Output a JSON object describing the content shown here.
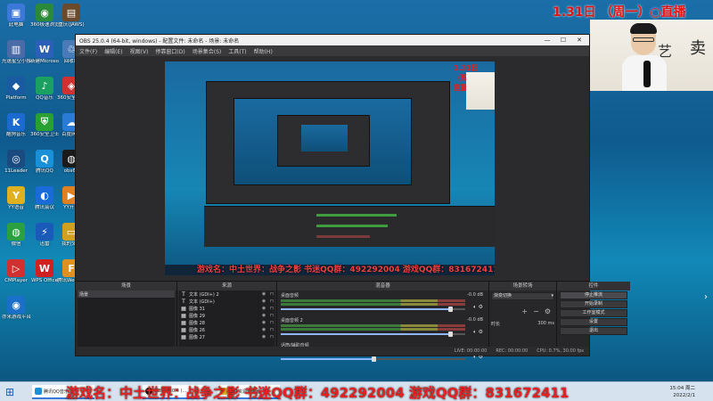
{
  "desktop_icons": [
    {
      "label": "此电脑",
      "color": "#3b78d8",
      "glyph": "▣"
    },
    {
      "label": "360极速浏览器",
      "color": "#2a8a3a",
      "glyph": "◉"
    },
    {
      "label": "重庆(JAWS)",
      "color": "#6a4a2a",
      "glyph": "▤"
    },
    {
      "label": "光速星空小报",
      "color": "#4a6aa8",
      "glyph": "▥"
    },
    {
      "label": "新建Microsoft...",
      "color": "#2b5fb8",
      "glyph": "W"
    },
    {
      "label": "回收站",
      "color": "#4a7ab8",
      "glyph": "♲"
    },
    {
      "label": "Platform",
      "color": "#1a5aa0",
      "glyph": "◆"
    },
    {
      "label": "QQ音乐",
      "color": "#1aa060",
      "glyph": "♪"
    },
    {
      "label": "360安全管家",
      "color": "#d03030",
      "glyph": "◈"
    },
    {
      "label": "酷狗音乐",
      "color": "#1a6ad0",
      "glyph": "K"
    },
    {
      "label": "360安全卫士",
      "color": "#2aa030",
      "glyph": "⛨"
    },
    {
      "label": "百度网盘",
      "color": "#2a7ad8",
      "glyph": "☁"
    },
    {
      "label": "11Leader",
      "color": "#1a4a80",
      "glyph": "◎"
    },
    {
      "label": "腾讯QQ",
      "color": "#1a90d8",
      "glyph": "Q"
    },
    {
      "label": "obs64",
      "color": "#1a1a1a",
      "glyph": "◍"
    },
    {
      "label": "YY语音",
      "color": "#e0b020",
      "glyph": "Y"
    },
    {
      "label": "腾讯会议",
      "color": "#1a6ad8",
      "glyph": "◐"
    },
    {
      "label": "YY开播",
      "color": "#e08020",
      "glyph": "▶"
    },
    {
      "label": "微信",
      "color": "#2aa040",
      "glyph": "◍"
    },
    {
      "label": "迅雷",
      "color": "#1a5ab8",
      "glyph": "⚡"
    },
    {
      "label": "我的文档",
      "color": "#d0a020",
      "glyph": "▭"
    },
    {
      "label": "CMPlayer",
      "color": "#d03030",
      "glyph": "▷"
    },
    {
      "label": "WPS Office",
      "color": "#d02020",
      "glyph": "W"
    },
    {
      "label": "腾讯WeGame",
      "color": "#e09020",
      "glyph": "F"
    },
    {
      "label": "亦米游戏平台",
      "color": "#1a70c8",
      "glyph": "◉"
    }
  ],
  "obs": {
    "title": "OBS 25.0.4 (64-bit, windows) - 配置文件: 未命名 - 场景: 未命名",
    "menu": [
      "文件(F)",
      "编辑(E)",
      "视图(V)",
      "停靠窗口(D)",
      "场景集合(S)",
      "工具(T)",
      "帮助(H)"
    ],
    "window_buttons": [
      "—",
      "☐",
      "✕"
    ],
    "preview": {
      "title": "1.31日 （周一）○直播",
      "scroll": "游戏名：中土世界：战争之影  书迷QQ群：492292004   游戏QQ群：831672411"
    },
    "docks": {
      "scenes": {
        "header": "场景",
        "items": [
          "场景"
        ]
      },
      "sources": {
        "header": "来源",
        "items": [
          {
            "icon": "T",
            "name": "文本 (GDI+) 2"
          },
          {
            "icon": "T",
            "name": "文本 (GDI+)"
          },
          {
            "icon": "▦",
            "name": "图像 31"
          },
          {
            "icon": "▦",
            "name": "图像 29"
          },
          {
            "icon": "▦",
            "name": "图像 28"
          },
          {
            "icon": "▦",
            "name": "图像 26"
          },
          {
            "icon": "▦",
            "name": "图像 27"
          }
        ]
      },
      "mixer": {
        "header": "混音器",
        "channels": [
          {
            "name": "桌面音频",
            "db": "-0.0 dB",
            "fader": 0.92
          },
          {
            "name": "桌面音频 2",
            "db": "-0.0 dB",
            "fader": 0.92
          },
          {
            "name": "话筒/辅助音频",
            "db": "",
            "fader": 0.5
          }
        ]
      },
      "transitions": {
        "header": "场景转场",
        "selected": "渐变切换",
        "duration_label": "时长",
        "duration": "300 ms"
      },
      "controls": {
        "header": "控件",
        "buttons": [
          "停止推流",
          "开始录制",
          "工作室模式",
          "设置",
          "退出"
        ]
      }
    },
    "statusbar": {
      "live": "LIVE: 00:00:00",
      "rec": "REC: 00:00:00",
      "cpu": "CPU: 0.7%, 30.00 fps"
    },
    "foot_buttons": [
      "+",
      "−",
      "∧",
      "∨"
    ]
  },
  "overlay": {
    "date_title": "1.31日  （周一）○直播",
    "scroll_text": "游戏名：中土世界：战争之影  书迷QQ群：492292004    游戏QQ群：831672411",
    "calligraphy_a": "艺",
    "calligraphy_b": "卖"
  },
  "taskbar": {
    "start_glyph": "⊞",
    "apps": [
      {
        "label": "腾讯QQ音乐..."
      },
      {
        "label": "OBS 25.0.4 (..."
      },
      {
        "label": "文件资源管理器"
      }
    ],
    "clock_time": "15:04 周二",
    "clock_date": "2022/2/1"
  },
  "colors": {
    "accent_red": "#e01414",
    "obs_bg": "#2b2b2e",
    "desktop_blue": "#1786b5"
  }
}
